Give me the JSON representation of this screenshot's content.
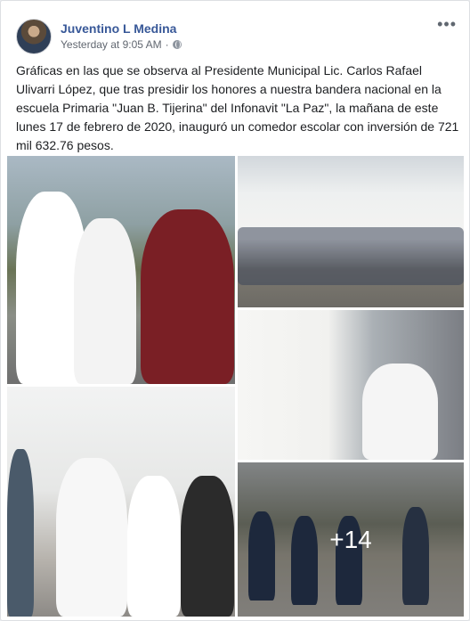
{
  "post": {
    "author": "Juventino L Medina",
    "timestamp": "Yesterday at 9:05 AM",
    "separator": "·",
    "privacy_icon": "globe-icon",
    "more_icon": "ellipsis-icon",
    "more_glyph": "•••",
    "caption": "Gráficas en las que se observa al Presidente Municipal Lic. Carlos Rafael Ulivarri López, que tras presidir los honores a nuestra bandera nacional en la escuela Primaria \"Juan B. Tijerina\" del Infonavit \"La Paz\", la mañana de este lunes 17 de febrero de 2020, inauguró un comedor escolar con inversión de 721 mil 632.76 pesos."
  },
  "photos": {
    "more_count": "+14"
  }
}
